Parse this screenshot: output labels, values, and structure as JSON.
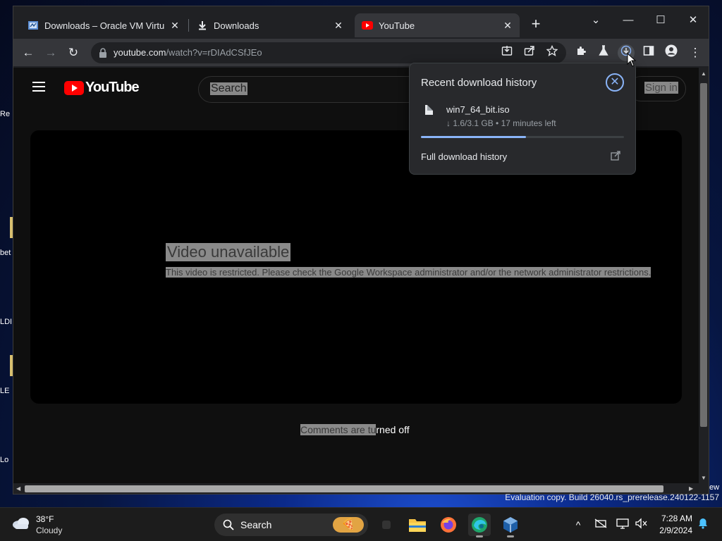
{
  "desktop": {
    "icon_labels": [
      "Re",
      "bet",
      "LDI",
      "LE",
      "Lo",
      "ew"
    ]
  },
  "browser": {
    "tabs": [
      {
        "label": "Downloads – Oracle VM VirtualBox",
        "close": "✕"
      },
      {
        "label": "Downloads",
        "close": "✕"
      },
      {
        "label": "YouTube",
        "close": "✕"
      }
    ],
    "new_tab": "+",
    "window_controls": {
      "tab_search": "⌄",
      "minimize": "—",
      "maximize": "☐",
      "close": "✕"
    },
    "toolbar": {
      "back": "←",
      "forward": "→",
      "reload": "↻",
      "url_host": "youtube.com",
      "url_path": "/watch?v=rDIAdCSfJEo",
      "menu": "⋮"
    }
  },
  "youtube": {
    "logo_text": "YouTube",
    "search_placeholder": "Search",
    "sign_in": "Sign in",
    "video_title": "Video unavailable",
    "video_message": "This video is restricted. Please check the Google Workspace administrator and/or the network administrator restrictions.",
    "comments_selected": "Comments are tu",
    "comments_rest": "rned off"
  },
  "download_panel": {
    "title": "Recent download history",
    "close": "✕",
    "file_name": "win7_64_bit.iso",
    "status": "↓ 1.6/3.1 GB • 17 minutes left",
    "progress_percent": 51.6,
    "full_history": "Full download history"
  },
  "watermark": "Evaluation copy. Build 26040.rs_prerelease.240122-1157",
  "taskbar": {
    "weather_temp": "38°F",
    "weather_cond": "Cloudy",
    "search_label": "Search",
    "tray_chevron": "^",
    "time": "7:28 AM",
    "date": "2/9/2024"
  },
  "colors": {
    "accent": "#8ab4f8",
    "youtube_red": "#ff0000",
    "tab_active": "#35363a",
    "tab_strip": "#202124"
  }
}
